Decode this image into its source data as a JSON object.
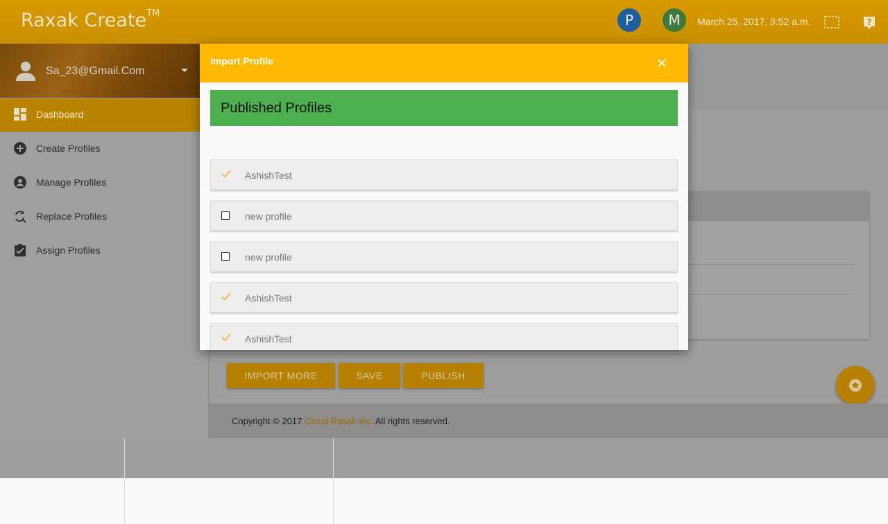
{
  "header": {
    "app_title": "Raxak Create",
    "trademark": "TM",
    "avatars": [
      {
        "letter": "P",
        "color": "#1f5e9c"
      },
      {
        "letter": "M",
        "color": "#3f7a3c"
      }
    ],
    "datetime": "March 25, 2017, 9:52 a.m."
  },
  "sidebar": {
    "user_email": "Sa_23@Gmail.Com",
    "items": [
      {
        "label": "Dashboard",
        "icon": "dashboard-icon"
      },
      {
        "label": "Create Profiles",
        "icon": "add-circle-icon"
      },
      {
        "label": "Manage Profiles",
        "icon": "account-circle-icon"
      },
      {
        "label": "Replace Profiles",
        "icon": "find-replace-icon"
      },
      {
        "label": "Assign Profiles",
        "icon": "assignment-check-icon"
      }
    ]
  },
  "main": {
    "buttons": [
      "IMPORT MORE",
      "SAVE",
      "PUBLISH"
    ],
    "footer": {
      "prefix": "Copyright © 2017 ",
      "brand": "Cloud Raxak Inc.",
      "suffix": " All rights reserved."
    }
  },
  "modal": {
    "title": "Import Profile",
    "section_title": "Published Profiles",
    "items": [
      {
        "label": "AshishTest",
        "checked": true
      },
      {
        "label": "new profile",
        "checked": false
      },
      {
        "label": "new profile",
        "checked": false
      },
      {
        "label": "AshishTest",
        "checked": true
      },
      {
        "label": "AshishTest",
        "checked": true
      }
    ]
  },
  "colors": {
    "accent": "#ffb900",
    "section_green": "#4caf50",
    "check_orange": "#f5a623"
  }
}
